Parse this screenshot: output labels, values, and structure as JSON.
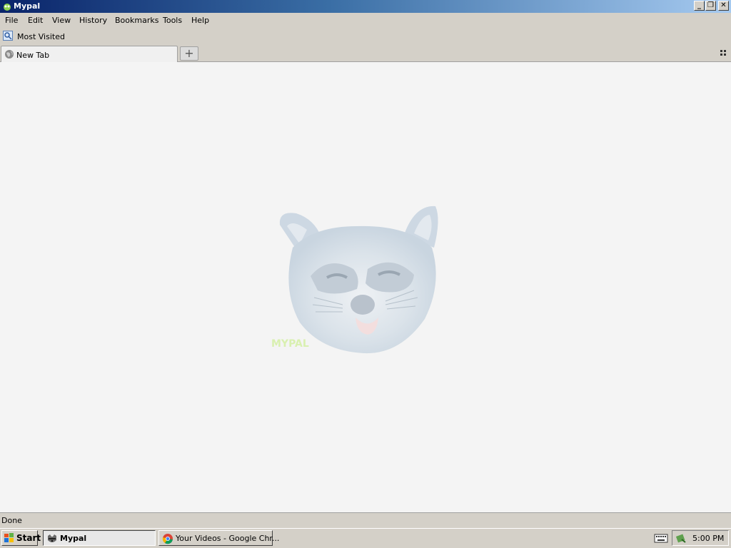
{
  "window": {
    "title": "Mypal",
    "controls": {
      "minimize": "_",
      "restore": "❐",
      "close": "✕"
    }
  },
  "menu": [
    {
      "label": "File"
    },
    {
      "label": "Edit"
    },
    {
      "label": "View"
    },
    {
      "label": "History"
    },
    {
      "label": "Bookmarks"
    },
    {
      "label": "Tools"
    },
    {
      "label": "Help"
    }
  ],
  "bookmarks": {
    "most_visited": "Most Visited"
  },
  "tabs": {
    "active": "New Tab",
    "new_tab_symbol": "+"
  },
  "content": {
    "logo_text": "MYPAL"
  },
  "status": {
    "text": "Done"
  },
  "taskbar": {
    "start": "Start",
    "tasks": [
      {
        "label": "Mypal"
      },
      {
        "label": "Your Videos - Google Chr..."
      }
    ],
    "clock": "5:00 PM"
  }
}
